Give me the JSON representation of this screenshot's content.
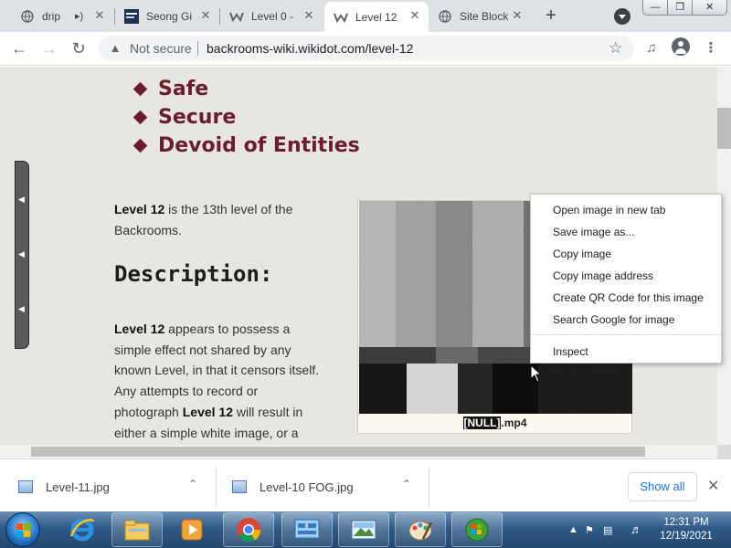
{
  "browser": {
    "tabs": [
      {
        "title": "drip",
        "icon": "globe-icon",
        "audio": true
      },
      {
        "title": "Seong Gi",
        "icon": "video-thumbnail-icon"
      },
      {
        "title": "Level 0 -",
        "icon": "wikidot-icon"
      },
      {
        "title": "Level 12",
        "icon": "wikidot-icon",
        "active": true
      },
      {
        "title": "Site Block",
        "icon": "globe-icon"
      }
    ],
    "security_label": "Not secure",
    "url": "backrooms-wiki.wikidot.com/level-12"
  },
  "page": {
    "bullets": [
      "Safe",
      "Secure",
      "Devoid of Entities"
    ],
    "intro": {
      "bold": "Level 12",
      "rest": " is the 13th level of the Backrooms."
    },
    "heading": "Description:",
    "body": {
      "bold1": "Level 12",
      "text1": " appears to possess a simple effect not shared by any known Level, in that it censors itself. Any attempts to record or photograph ",
      "bold2": "Level 12",
      "text2": " will result in either a simple white image, or a"
    },
    "image_caption": {
      "null_tag": "[NULL]",
      "suffix": ".mp4"
    },
    "accent_color": "#6b1e2a"
  },
  "context_menu": {
    "items": [
      "Open image in new tab",
      "Save image as...",
      "Copy image",
      "Copy image address",
      "Create QR Code for this image",
      "Search Google for image"
    ],
    "inspect": "Inspect"
  },
  "downloads": {
    "items": [
      "Level-11.jpg",
      "Level-10 FOG.jpg"
    ],
    "show_all": "Show all"
  },
  "taskbar": {
    "time": "12:31 PM",
    "date": "12/19/2021"
  }
}
